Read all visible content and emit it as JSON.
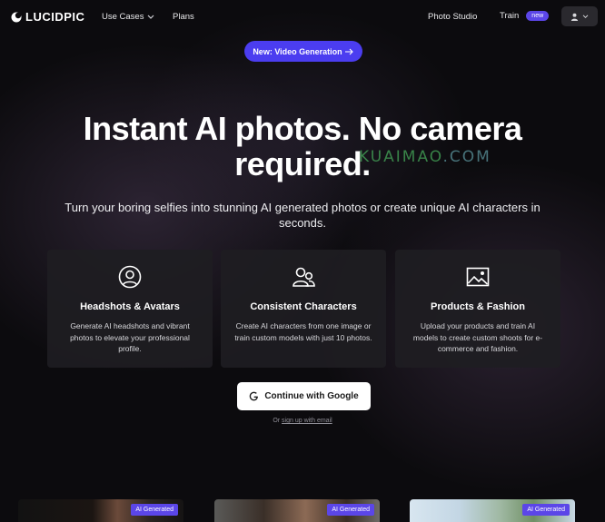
{
  "brand": {
    "name": "LUCIDPIC"
  },
  "nav": {
    "use_cases": "Use Cases",
    "plans": "Plans",
    "photo_studio": "Photo Studio",
    "train": "Train",
    "train_badge": "new"
  },
  "announcement": {
    "label": "New: Video Generation"
  },
  "hero": {
    "headline_line1": "Instant AI photos. No camera",
    "headline_line2": "required.",
    "subheading": "Turn your boring selfies into stunning AI generated photos or create unique AI characters in seconds."
  },
  "features": [
    {
      "icon": "user-circle-icon",
      "title": "Headshots & Avatars",
      "description": "Generate AI headshots and vibrant photos to elevate your professional profile."
    },
    {
      "icon": "users-icon",
      "title": "Consistent Characters",
      "description": "Create AI characters from one image or train custom models with just 10 photos."
    },
    {
      "icon": "image-icon",
      "title": "Products & Fashion",
      "description": "Upload your products and train AI models to create custom shoots for e-commerce and fashion."
    }
  ],
  "cta": {
    "google_label": "Continue with Google",
    "alt_prefix": "Or",
    "alt_link": "sign up with email"
  },
  "gallery": {
    "tag": "AI Generated"
  },
  "watermark": {
    "part1": "KUAIMAO",
    "part2": ".COM"
  },
  "colors": {
    "accent": "#4b3df0",
    "background": "#0c0b0e",
    "card": "#1e1d22"
  }
}
